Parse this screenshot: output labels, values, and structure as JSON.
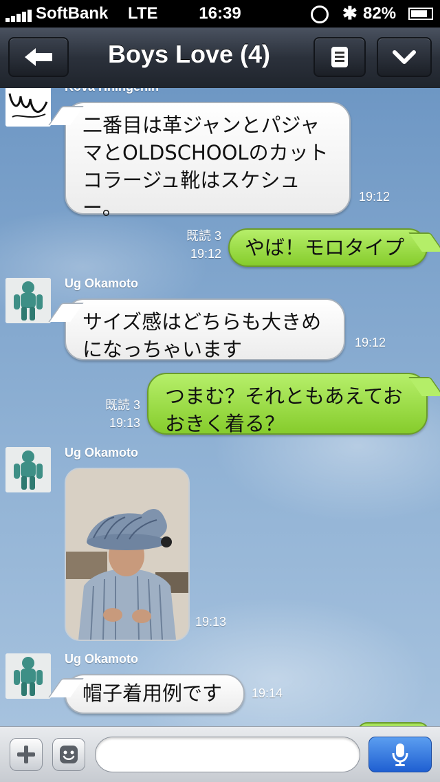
{
  "status_bar": {
    "carrier": "SoftBank",
    "network": "LTE",
    "time": "16:39",
    "battery": "82%",
    "battery_level": 0.82
  },
  "header": {
    "title": "Boys Love (4)",
    "back_icon": "arrow-left-icon",
    "menu_icon": "list-icon",
    "dropdown_icon": "chevron-down-icon"
  },
  "messages": [
    {
      "direction": "in",
      "sender": "Kova Hningenin",
      "text_lines": [
        "二番目は革ジャンとパジャ",
        "マとOLDSCHOOLのカット",
        "コラージュ靴はスケシュ",
        "ー。"
      ],
      "time": "19:12"
    },
    {
      "direction": "out",
      "read": "既読 3",
      "text_lines": [
        "やば！モロタイプ"
      ],
      "time": "19:12"
    },
    {
      "direction": "in",
      "sender": "Ug Okamoto",
      "text_lines": [
        "サイズ感はどちらも大きめ",
        "になっちゃいます"
      ],
      "time": "19:12"
    },
    {
      "direction": "out",
      "read": "既読 3",
      "text_lines": [
        "つまむ？それともあえてお",
        "おきく着る？"
      ],
      "time": "19:13"
    },
    {
      "direction": "in",
      "sender": "Ug Okamoto",
      "photo": true,
      "time": "19:13"
    },
    {
      "direction": "in",
      "sender": "Ug Okamoto",
      "text_lines": [
        "帽子着用例です"
      ],
      "time": "19:14"
    }
  ],
  "input_bar": {
    "placeholder": "",
    "add_icon": "plus-icon",
    "emoji_icon": "smiley-icon",
    "mic_icon": "microphone-icon"
  },
  "colors": {
    "incoming_bubble": "#ffffff",
    "outgoing_bubble": "#9fe04a",
    "nav_bar": "#2b313b",
    "mic_button": "#2f75e0"
  }
}
